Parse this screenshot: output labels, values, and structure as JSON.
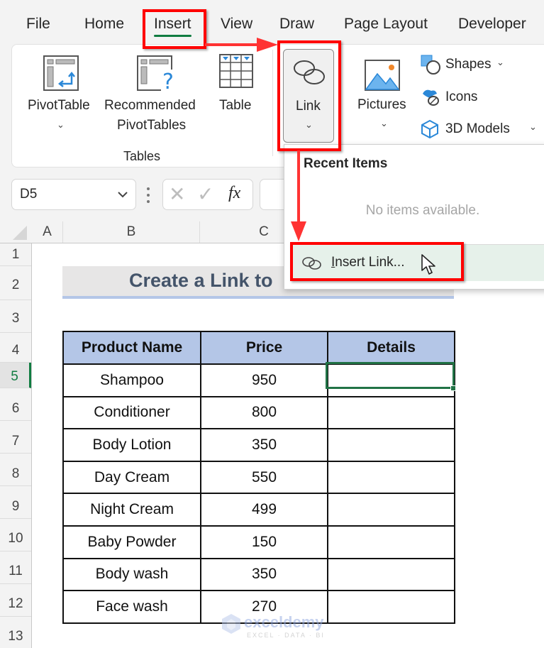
{
  "menu": {
    "tabs": [
      {
        "label": "File"
      },
      {
        "label": "Home"
      },
      {
        "label": "Insert",
        "active": true
      },
      {
        "label": "View"
      },
      {
        "label": "Draw"
      },
      {
        "label": "Page Layout"
      },
      {
        "label": "Developer"
      }
    ]
  },
  "ribbon": {
    "tables_group": {
      "label": "Tables",
      "pivottable": "PivotTable",
      "recommended_line1": "Recommended",
      "recommended_line2": "PivotTables",
      "table": "Table"
    },
    "link_button": "Link",
    "pictures_button": "Pictures",
    "shapes_button": "Shapes",
    "icons_button": "Icons",
    "models_button": "3D Models",
    "chevron": "⌄"
  },
  "formula_bar": {
    "name_box": "D5",
    "cancel_icon": "✕",
    "enter_icon": "✓",
    "fx_label": "fx",
    "formula_value": ""
  },
  "link_dropdown": {
    "title": "Recent Items",
    "empty_message": "No items available.",
    "insert_link_underline": "I",
    "insert_link_rest": "nsert Link..."
  },
  "sheet": {
    "columns": [
      "A",
      "B",
      "C"
    ],
    "rows": [
      "1",
      "2",
      "3",
      "4",
      "5",
      "6",
      "7",
      "8",
      "9",
      "10",
      "11",
      "12",
      "13"
    ],
    "selected_row": "5",
    "selected_cell": "D5",
    "title": "Create a Link to",
    "table": {
      "headers": [
        "Product Name",
        "Price",
        "Details"
      ],
      "rows": [
        {
          "product": "Shampoo",
          "price": "950",
          "details": ""
        },
        {
          "product": "Conditioner",
          "price": "800",
          "details": ""
        },
        {
          "product": "Body Lotion",
          "price": "350",
          "details": ""
        },
        {
          "product": "Day Cream",
          "price": "550",
          "details": ""
        },
        {
          "product": "Night Cream",
          "price": "499",
          "details": ""
        },
        {
          "product": "Baby Powder",
          "price": "150",
          "details": ""
        },
        {
          "product": "Body wash",
          "price": "350",
          "details": ""
        },
        {
          "product": "Face wash",
          "price": "270",
          "details": ""
        }
      ]
    }
  },
  "watermark": {
    "name": "exceldemy",
    "tagline": "EXCEL · DATA · BI"
  },
  "colors": {
    "accent_green": "#107c41",
    "annotation_red": "#ff0000",
    "header_fill": "#b4c6e7",
    "title_text": "#44546a"
  }
}
